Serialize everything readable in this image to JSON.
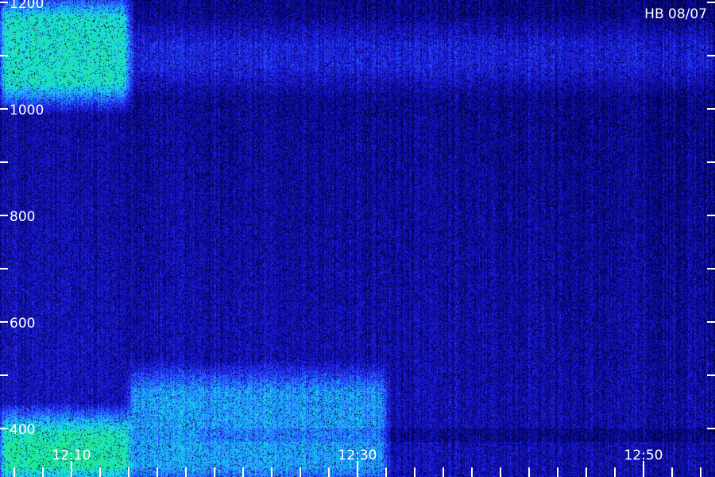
{
  "chart_data": {
    "type": "heatmap",
    "title": "HB 08/07",
    "xlabel": "",
    "ylabel": "",
    "x_axis": {
      "unit": "time (HH:MM)",
      "range": [
        "12:05",
        "12:55"
      ],
      "labels": [
        "12:10",
        "12:30",
        "12:50"
      ],
      "minor_tick_step_min": 2
    },
    "y_axis": {
      "range": [
        300,
        1200
      ],
      "labels": [
        400,
        600,
        800,
        1000,
        1200
      ],
      "minor_tick_step": 100
    },
    "colormap": [
      "#000033",
      "#0b0ba8",
      "#2a2aff",
      "#1f9bff",
      "#19e5e5",
      "#22e680",
      "#30ff30"
    ],
    "features": [
      {
        "name": "strong low band",
        "x_range": [
          "12:05",
          "12:14"
        ],
        "y_range": [
          300,
          420
        ],
        "level": "high"
      },
      {
        "name": "upper band",
        "x_range": [
          "12:05",
          "12:14"
        ],
        "y_range": [
          1020,
          1200
        ],
        "level": "high"
      },
      {
        "name": "weak upper band",
        "x_range": [
          "12:14",
          "12:55"
        ],
        "y_range": [
          1050,
          1150
        ],
        "level": "low"
      },
      {
        "name": "fading low band",
        "x_range": [
          "12:14",
          "12:32"
        ],
        "y_range": [
          300,
          500
        ],
        "level": "medium"
      }
    ],
    "grid": false,
    "legend": "none"
  }
}
